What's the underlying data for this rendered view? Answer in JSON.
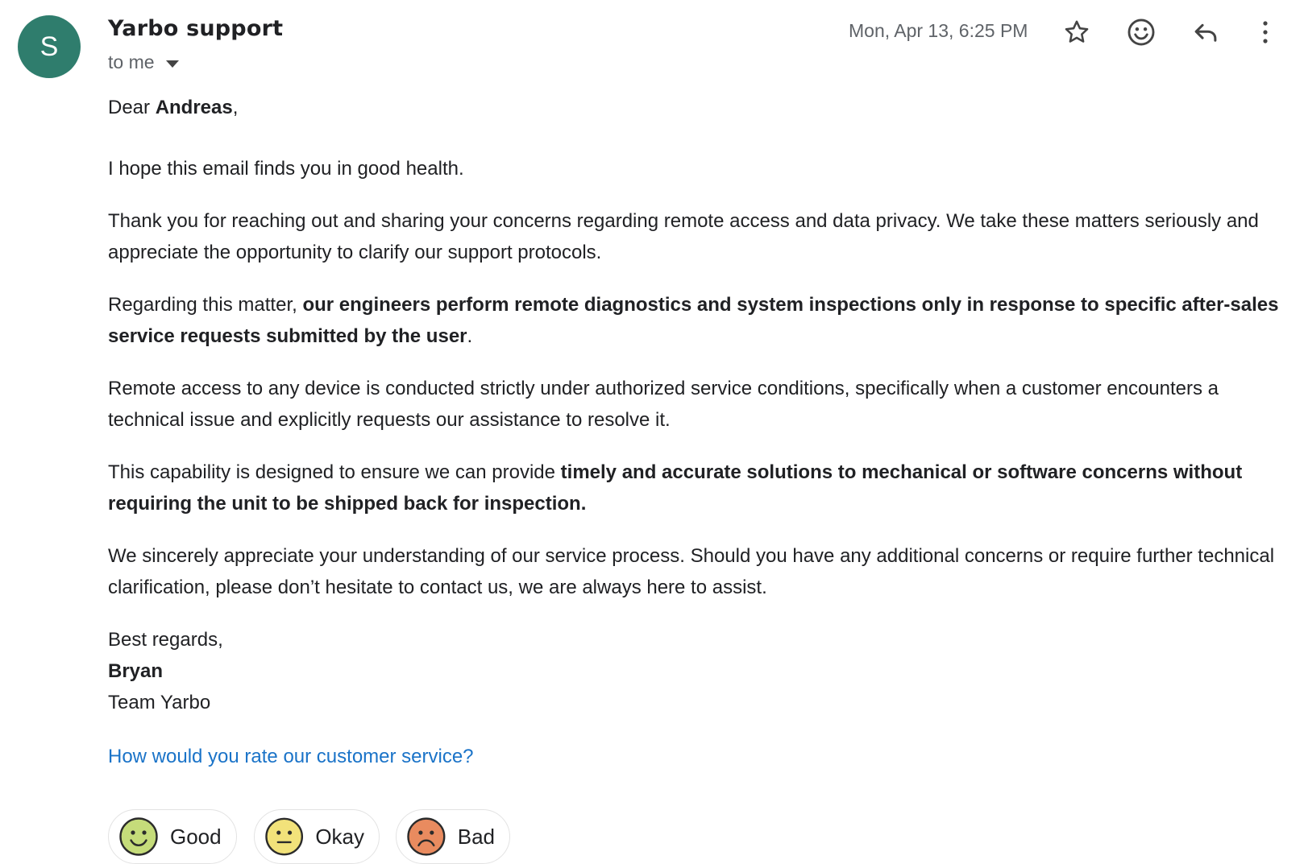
{
  "header": {
    "avatar_letter": "S",
    "avatar_color": "#2f7d6d",
    "sender_name": "Yarbo support",
    "recipient": "to me",
    "date": "Mon, Apr 13, 6:25 PM",
    "actions": [
      "star-icon",
      "emoji-reaction-icon",
      "reply-icon",
      "more-options-icon"
    ]
  },
  "body": {
    "greeting_prefix": "Dear ",
    "greeting_name": "Andreas",
    "greeting_suffix": ",",
    "p1": "I hope this email finds you in good health.",
    "p2": "Thank you for reaching out and sharing your concerns regarding remote access and data privacy. We take these matters seriously and appreciate the opportunity to clarify our support protocols.",
    "p3_prefix": "Regarding this matter, ",
    "p3_bold": "our engineers perform remote diagnostics and system inspections only in response to specific after-sales service requests submitted by the user",
    "p3_suffix": ".",
    "p4": "Remote access to any device is conducted strictly under authorized service conditions, specifically when a customer encounters a technical issue and explicitly requests our assistance to resolve it.",
    "p5_prefix": "This capability is designed to ensure we can provide ",
    "p5_bold": "timely and accurate solutions to mechanical or software concerns without requiring the unit to be shipped back for inspection.",
    "p6": "We sincerely appreciate your understanding of our service process. Should you have any additional concerns or require further technical clarification, please don’t hesitate to contact us, we are always here to assist.",
    "signoff": "Best regards,",
    "signer_name": "Bryan",
    "signer_team": "Team Yarbo"
  },
  "feedback": {
    "question": "How would you rate our customer service?",
    "link_color": "#1a73c8",
    "options": [
      {
        "label": "Good",
        "color": "#c5dc7a"
      },
      {
        "label": "Okay",
        "color": "#f2e27a"
      },
      {
        "label": "Bad",
        "color": "#e98b5f"
      }
    ]
  }
}
